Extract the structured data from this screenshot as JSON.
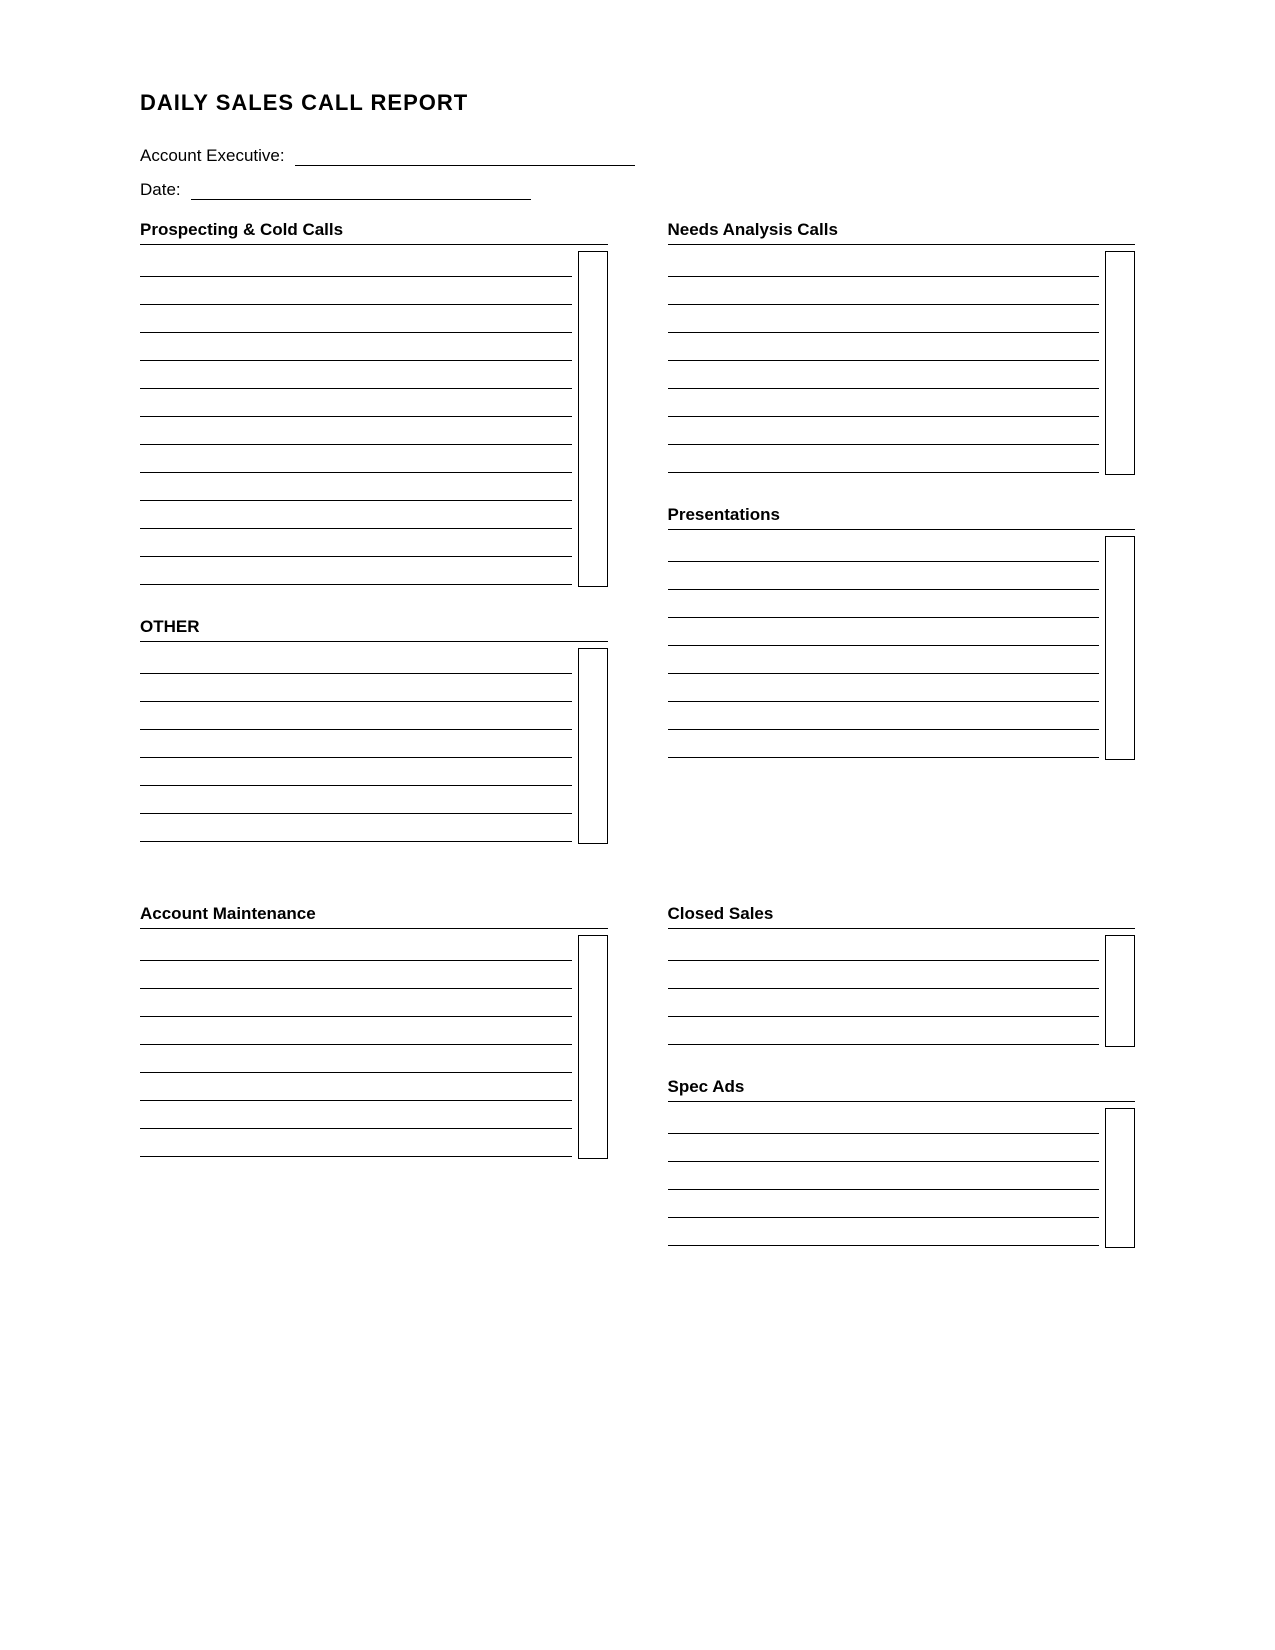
{
  "title": "DAILY SALES CALL REPORT",
  "fields": {
    "account_executive_label": "Account Executive:",
    "date_label": "Date:"
  },
  "sections": {
    "prospecting": {
      "title": "Prospecting & Cold Calls",
      "rows": 12
    },
    "needs_analysis": {
      "title": "Needs Analysis Calls",
      "rows": 8
    },
    "other": {
      "title": "OTHER",
      "rows": 7
    },
    "presentations": {
      "title": "Presentations",
      "rows": 8
    },
    "account_maintenance": {
      "title": "Account Maintenance",
      "rows": 8
    },
    "closed_sales": {
      "title": "Closed Sales",
      "rows": 4
    },
    "spec_ads": {
      "title": "Spec Ads",
      "rows": 5
    }
  }
}
